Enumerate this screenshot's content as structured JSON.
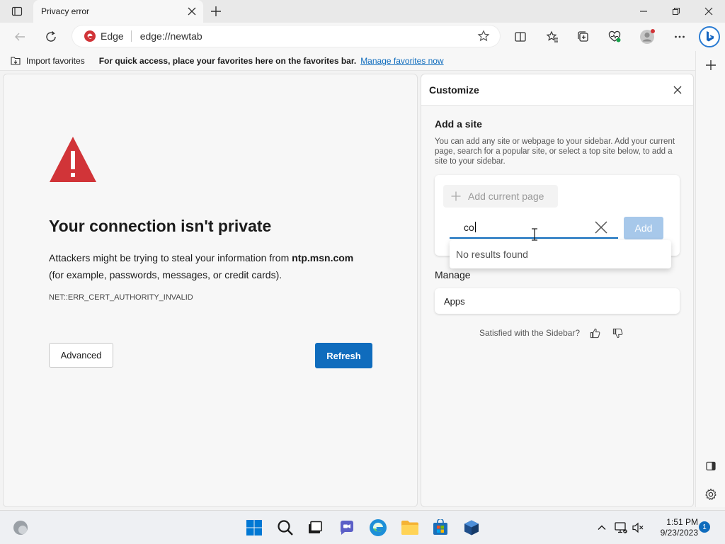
{
  "tab": {
    "title": "Privacy error"
  },
  "address": {
    "site_label": "Edge",
    "url": "edge://newtab"
  },
  "favorites_bar": {
    "import_label": "Import favorites",
    "message": "For quick access, place your favorites here on the favorites bar.",
    "manage_link": "Manage favorites now"
  },
  "error_page": {
    "title": "Your connection isn't private",
    "body_prefix": "Attackers might be trying to steal your information from ",
    "host": "ntp.msn.com",
    "body_suffix": "(for example, passwords, messages, or credit cards).",
    "code": "NET::ERR_CERT_AUTHORITY_INVALID",
    "advanced_label": "Advanced",
    "refresh_label": "Refresh"
  },
  "customize": {
    "title": "Customize",
    "add_site_title": "Add a site",
    "add_site_desc": "You can add any site or webpage to your sidebar. Add your current page, search for a popular site, or select a top site below, to add a site to your sidebar.",
    "add_current_label": "Add current page",
    "input_value": "co",
    "add_label": "Add",
    "no_results": "No results found",
    "manage_title": "Manage",
    "apps_label": "Apps",
    "feedback_label": "Satisfied with the Sidebar?"
  },
  "taskbar": {
    "time": "1:51 PM",
    "date": "9/23/2023",
    "notification_count": "1"
  },
  "colors": {
    "accent": "#0f6cbd",
    "warning_red": "#d13438",
    "add_disabled": "#a7c8ea"
  }
}
